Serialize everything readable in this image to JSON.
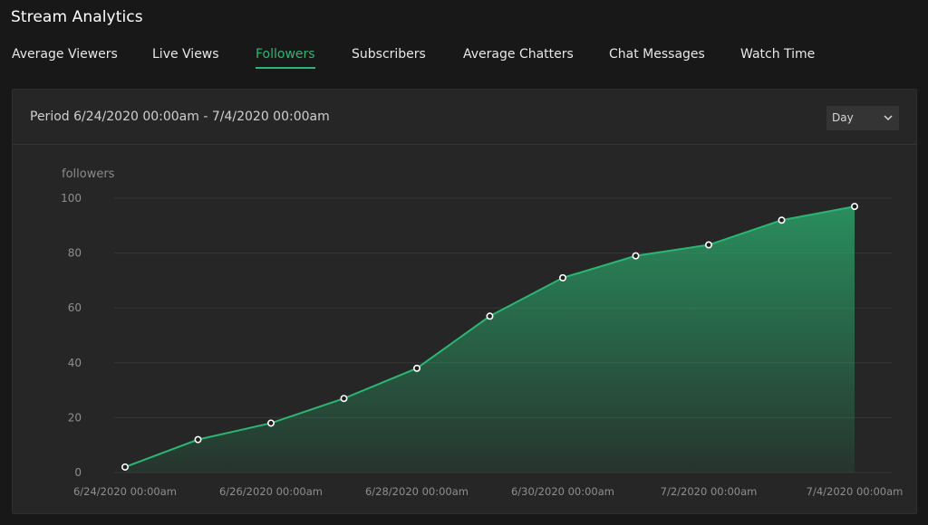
{
  "app": {
    "title": "Stream Analytics"
  },
  "tabs": [
    {
      "label": "Average Viewers",
      "active": false
    },
    {
      "label": "Live Views",
      "active": false
    },
    {
      "label": "Followers",
      "active": true
    },
    {
      "label": "Subscribers",
      "active": false
    },
    {
      "label": "Average Chatters",
      "active": false
    },
    {
      "label": "Chat Messages",
      "active": false
    },
    {
      "label": "Watch Time",
      "active": false
    }
  ],
  "panel": {
    "period": "Period 6/24/2020 00:00am - 7/4/2020 00:00am",
    "interval": {
      "selected": "Day",
      "icon": "chevron-down-icon"
    }
  },
  "colors": {
    "accent": "#2bb673",
    "background": "#181818",
    "panel": "#262626"
  },
  "chart_data": {
    "type": "area",
    "ylabel": "followers",
    "x": [
      "6/24/2020 00:00am",
      "6/25/2020 00:00am",
      "6/26/2020 00:00am",
      "6/27/2020 00:00am",
      "6/28/2020 00:00am",
      "6/29/2020 00:00am",
      "6/30/2020 00:00am",
      "7/1/2020 00:00am",
      "7/2/2020 00:00am",
      "7/3/2020 00:00am",
      "7/4/2020 00:00am"
    ],
    "values": [
      2,
      12,
      18,
      27,
      38,
      57,
      71,
      79,
      83,
      92,
      97
    ],
    "xtick_labels": [
      "6/24/2020 00:00am",
      "6/26/2020 00:00am",
      "6/28/2020 00:00am",
      "6/30/2020 00:00am",
      "7/2/2020 00:00am",
      "7/4/2020 00:00am"
    ],
    "yticks": [
      0,
      20,
      40,
      60,
      80,
      100
    ],
    "ylim": [
      0,
      100
    ],
    "grid": true,
    "legend": "none"
  }
}
